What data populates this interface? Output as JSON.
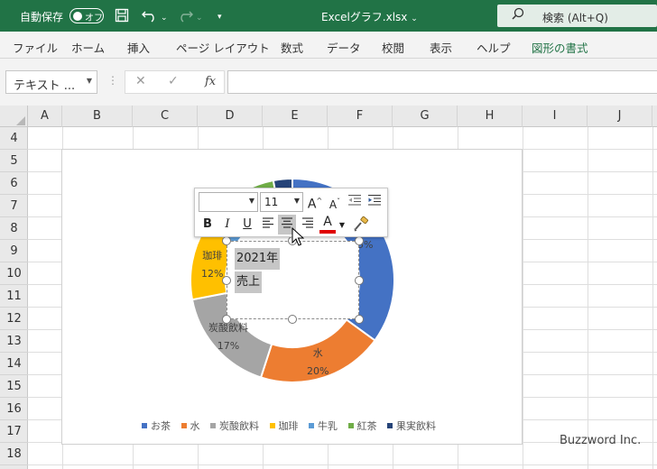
{
  "titlebar": {
    "autosave_label": "自動保存",
    "autosave_state": "オフ",
    "filename": "Excelグラフ.xlsx",
    "filename_chevron": "⌄",
    "search_placeholder": "検索 (Alt+Q)"
  },
  "ribbon": {
    "tabs": [
      "ファイル",
      "ホーム",
      "挿入",
      "ページ レイアウト",
      "数式",
      "データ",
      "校閲",
      "表示",
      "ヘルプ",
      "図形の書式"
    ]
  },
  "formula_bar": {
    "name_box": "テキスト ...",
    "fx_label": "fx",
    "formula": ""
  },
  "columns": [
    "A",
    "B",
    "C",
    "D",
    "E",
    "F",
    "G",
    "H",
    "I",
    "J"
  ],
  "rows": [
    "4",
    "5",
    "6",
    "7",
    "8",
    "9",
    "10",
    "11",
    "12",
    "13",
    "14",
    "15",
    "16",
    "17",
    "18"
  ],
  "chart_data": {
    "type": "pie",
    "variant": "doughnut",
    "categories": [
      "お茶",
      "水",
      "炭酸飲料",
      "珈琲",
      "牛乳",
      "紅茶",
      "果実飲料"
    ],
    "values": [
      35,
      20,
      17,
      12,
      8,
      5,
      3
    ],
    "data_labels": [
      {
        "name": "",
        "value": "35%"
      },
      {
        "name": "水",
        "value": "20%"
      },
      {
        "name": "炭酸飲料",
        "value": "17%"
      },
      {
        "name": "珈琲",
        "value": "12%"
      }
    ],
    "colors": [
      "#4472c4",
      "#ed7d31",
      "#a5a5a5",
      "#ffc000",
      "#5b9bd5",
      "#70ad47",
      "#264478"
    ],
    "legend_position": "bottom"
  },
  "text_box": {
    "line1": "2021年",
    "line2": "売上"
  },
  "mini_toolbar": {
    "font_name": "",
    "font_size": "11",
    "grow": "A",
    "shrink": "A",
    "bold": "B",
    "italic": "I",
    "underline": "U",
    "font_color_letter": "A",
    "font_color": "#e00000"
  },
  "watermark": "Buzzword Inc."
}
